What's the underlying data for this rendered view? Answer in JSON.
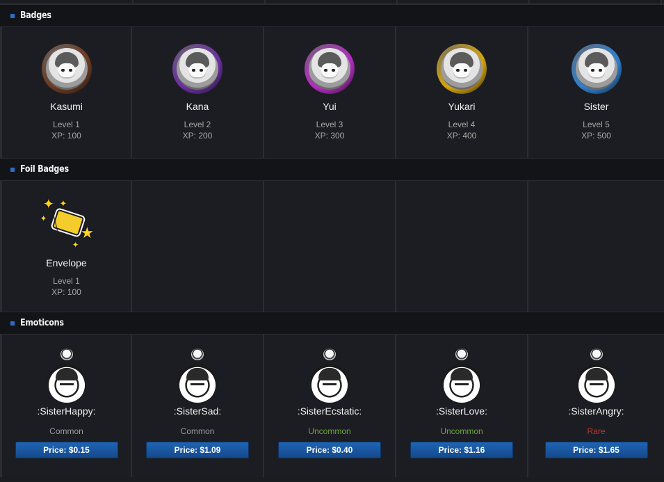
{
  "sections": {
    "badges": {
      "title": "Badges"
    },
    "foil": {
      "title": "Foil Badges"
    },
    "emoticons": {
      "title": "Emoticons"
    }
  },
  "badges": [
    {
      "name": "Kasumi",
      "level": "Level 1",
      "xp": "XP: 100",
      "ring": "#6b3b22"
    },
    {
      "name": "Kana",
      "level": "Level 2",
      "xp": "XP: 200",
      "ring": "#6b2fa3"
    },
    {
      "name": "Yui",
      "level": "Level 3",
      "xp": "XP: 300",
      "ring": "#b52cc2"
    },
    {
      "name": "Yukari",
      "level": "Level 4",
      "xp": "XP: 400",
      "ring": "#d4a30f"
    },
    {
      "name": "Sister",
      "level": "Level 5",
      "xp": "XP: 500",
      "ring": "#2f7fd0"
    }
  ],
  "foil_badges": [
    {
      "name": "Envelope",
      "level": "Level 1",
      "xp": "XP: 100",
      "icon": "envelope-sparkle-icon"
    }
  ],
  "emoticons": [
    {
      "name": ":SisterHappy:",
      "rarity": "Common",
      "rarity_color": "#9a9a9a",
      "price": "Price: $0.15"
    },
    {
      "name": ":SisterSad:",
      "rarity": "Common",
      "rarity_color": "#9a9a9a",
      "price": "Price: $1.09"
    },
    {
      "name": ":SisterEcstatic:",
      "rarity": "Uncommon",
      "rarity_color": "#6fa33b",
      "price": "Price: $0.40"
    },
    {
      "name": ":SisterLove:",
      "rarity": "Uncommon",
      "rarity_color": "#6fa33b",
      "price": "Price: $1.16"
    },
    {
      "name": ":SisterAngry:",
      "rarity": "Rare",
      "rarity_color": "#c23030",
      "price": "Price: $1.65"
    }
  ],
  "colors": {
    "accent": "#2a6fc7",
    "background": "#1b1c20",
    "header": "#131418"
  }
}
